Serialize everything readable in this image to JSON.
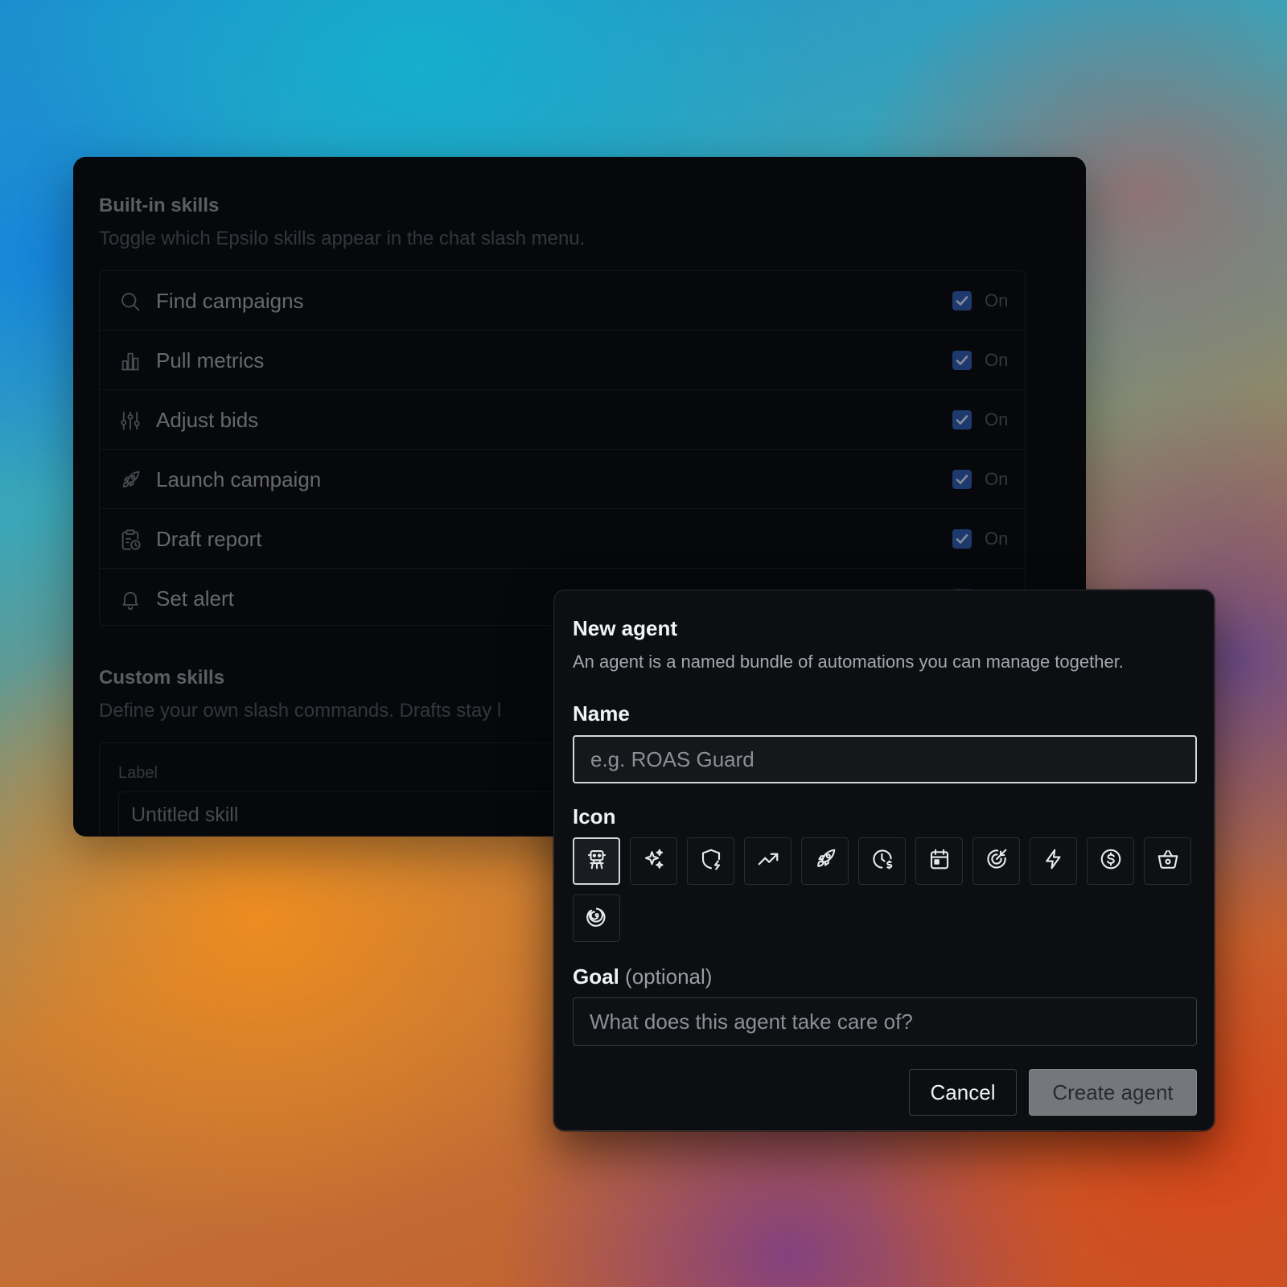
{
  "settings": {
    "builtin": {
      "title": "Built-in skills",
      "description": "Toggle which Epsilo skills appear in the chat slash menu.",
      "skills": [
        {
          "label": "Find campaigns",
          "icon": "search-icon",
          "checked": true,
          "state": "On"
        },
        {
          "label": "Pull metrics",
          "icon": "bar-chart-icon",
          "checked": true,
          "state": "On"
        },
        {
          "label": "Adjust bids",
          "icon": "sliders-icon",
          "checked": true,
          "state": "On"
        },
        {
          "label": "Launch campaign",
          "icon": "rocket-icon",
          "checked": true,
          "state": "On"
        },
        {
          "label": "Draft report",
          "icon": "clipboard-clock-icon",
          "checked": true,
          "state": "On"
        },
        {
          "label": "Set alert",
          "icon": "bell-icon",
          "checked": true,
          "state": ""
        }
      ]
    },
    "custom": {
      "title": "Custom skills",
      "description": "Define your own slash commands. Drafts stay l",
      "field_label": "Label",
      "field_value": "Untitled skill"
    }
  },
  "modal": {
    "title": "New agent",
    "description": "An agent is a named bundle of automations you can manage together.",
    "name_label": "Name",
    "name_placeholder": "e.g. ROAS Guard",
    "icon_label": "Icon",
    "icons": [
      "robot-icon",
      "sparkles-icon",
      "shield-bolt-icon",
      "trending-up-icon",
      "rocket-icon",
      "clock-dollar-icon",
      "calendar-icon",
      "target-arrow-icon",
      "bolt-icon",
      "dollar-circle-icon",
      "basket-icon",
      "spiral-icon"
    ],
    "selected_icon": "robot-icon",
    "goal_label": "Goal",
    "goal_optional": "(optional)",
    "goal_placeholder": "What does this agent take care of?",
    "cancel_label": "Cancel",
    "create_label": "Create agent"
  }
}
